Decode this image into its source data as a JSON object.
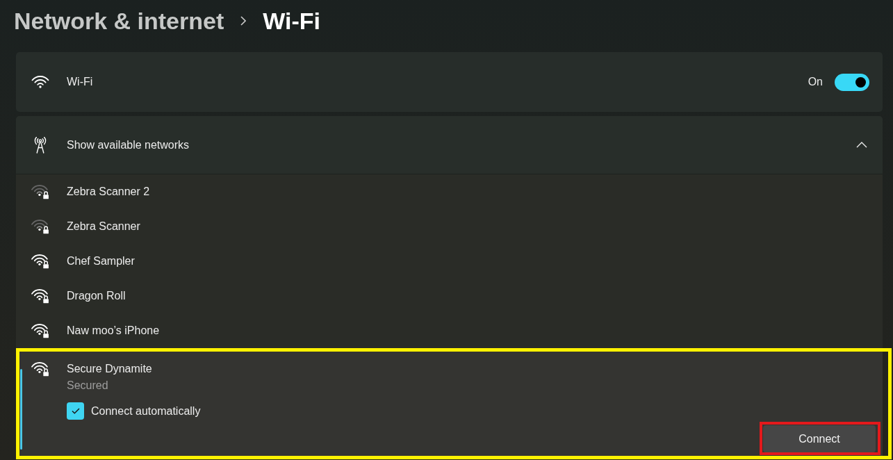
{
  "breadcrumb": [
    {
      "label": "Network & internet",
      "current": false
    },
    {
      "label": "Wi-Fi",
      "current": true
    }
  ],
  "wifi_card": {
    "label": "Wi-Fi",
    "state_label": "On",
    "on": true
  },
  "available_networks": {
    "label": "Show available networks",
    "expanded": true,
    "networks": [
      {
        "name": "Zebra Scanner 2",
        "kind": "weak",
        "secured": true,
        "selected": false
      },
      {
        "name": "Zebra Scanner",
        "kind": "weak",
        "secured": true,
        "selected": false
      },
      {
        "name": "Chef Sampler",
        "kind": "strong",
        "secured": true,
        "selected": false
      },
      {
        "name": "Dragon Roll",
        "kind": "strong",
        "secured": true,
        "selected": false
      },
      {
        "name": "Naw moo’s iPhone",
        "kind": "strong",
        "secured": true,
        "selected": false
      },
      {
        "name": "Secure Dynamite",
        "kind": "strong",
        "secured": true,
        "selected": true,
        "highlighted": true,
        "status": "Secured",
        "connect_automatically": {
          "label": "Connect automatically",
          "checked": true
        },
        "connect_button": {
          "label": "Connect",
          "highlighted": true
        }
      }
    ]
  }
}
